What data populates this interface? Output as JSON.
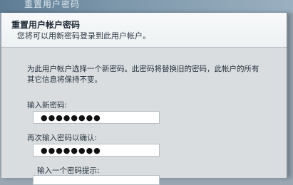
{
  "window": {
    "title": "重置用户密码"
  },
  "dialog": {
    "title": "重置用户帐户密码",
    "subtitle": "您将可以用新密码登录到此用户帐户。",
    "description": "为此用户帐户选择一个新密码。此密码将替换旧的密码，此帐户的所有其它信息将保持不变。",
    "new_password": {
      "label": "输入新密码:",
      "value": "●●●●●●●●"
    },
    "confirm_password": {
      "label": "再次输入密码以确认:",
      "value": "●●●●●●●●"
    },
    "hint": {
      "label": "输入一个密码提示:"
    }
  }
}
